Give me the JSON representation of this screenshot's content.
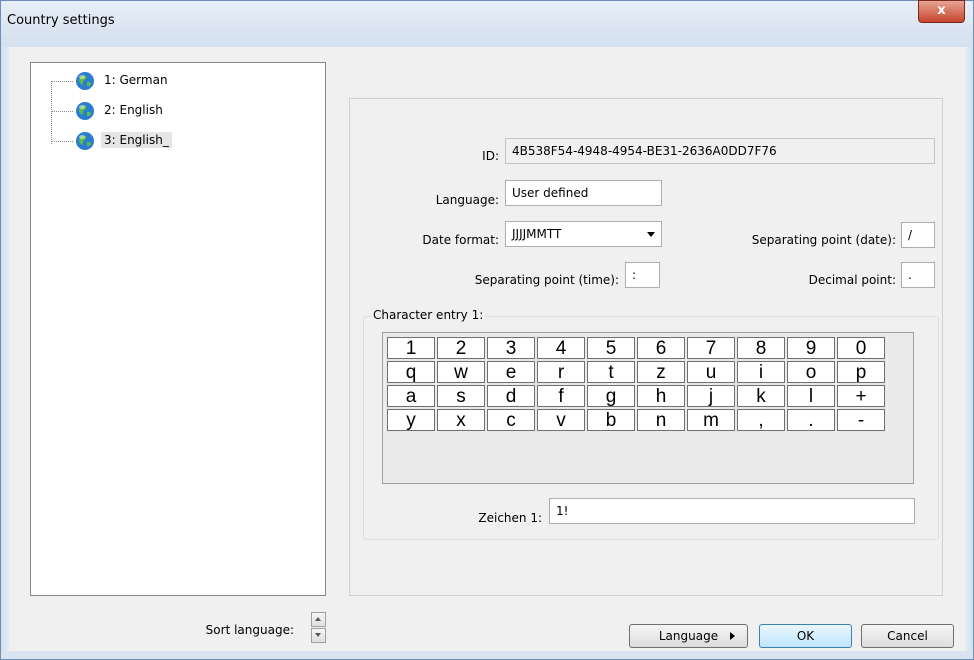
{
  "window": {
    "title": "Country settings",
    "close_label": "x"
  },
  "tree": {
    "items": [
      {
        "label": "1: German",
        "icon": "globe-icon"
      },
      {
        "label": "2: English",
        "icon": "globe-icon"
      },
      {
        "label": "3: English_",
        "icon": "globe-icon",
        "selected": true
      }
    ]
  },
  "form": {
    "id_label": "ID:",
    "id_value": "4B538F54-4948-4954-BE31-2636A0DD7F76",
    "language_label": "Language:",
    "language_value": "User defined",
    "date_format_label": "Date format:",
    "date_format_value": "JJJJMMTT",
    "sep_date_label": "Separating point (date):",
    "sep_date_value": "/",
    "sep_time_label": "Separating point (time):",
    "sep_time_value": ":",
    "decimal_label": "Decimal point:",
    "decimal_value": "."
  },
  "character_entry": {
    "group_title": "Character entry 1:",
    "keys": [
      [
        "1",
        "2",
        "3",
        "4",
        "5",
        "6",
        "7",
        "8",
        "9",
        "0"
      ],
      [
        "q",
        "w",
        "e",
        "r",
        "t",
        "z",
        "u",
        "i",
        "o",
        "p"
      ],
      [
        "a",
        "s",
        "d",
        "f",
        "g",
        "h",
        "j",
        "k",
        "l",
        "+"
      ],
      [
        "y",
        "x",
        "c",
        "v",
        "b",
        "n",
        "m",
        ",",
        ".",
        "-"
      ]
    ],
    "zeichen_label": "Zeichen 1:",
    "zeichen_value": "1!"
  },
  "footer": {
    "sort_label": "Sort language:",
    "language_button": "Language",
    "ok_button": "OK",
    "cancel_button": "Cancel"
  }
}
